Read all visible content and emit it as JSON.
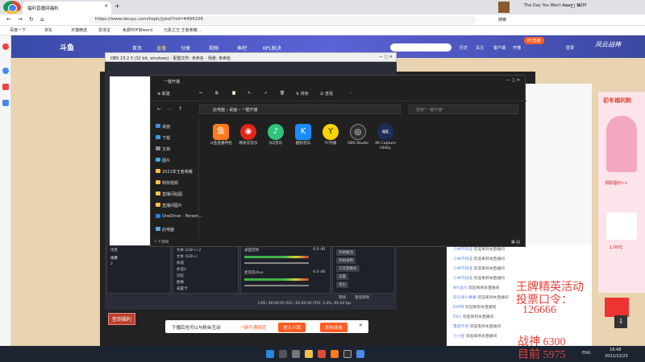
{
  "chrome": {
    "tab_title": "福利直播间福利",
    "url": "https://www.douyu.com/topic/jykzl?rid=4494106",
    "bookmarks": [
      "百度一下",
      "京东",
      "天猫精选",
      "爱淘宝",
      "免费PDF转word",
      "元素之王 王者荣耀..."
    ],
    "media_title": "The Day You Went Away - M2M",
    "search_hint": "搜索"
  },
  "douyu": {
    "logo": "斗鱼",
    "nav": [
      "首页",
      "直播",
      "分类",
      "视频",
      "鱼吧",
      "KPL秋决"
    ],
    "accent": "#ff5d23",
    "header_right": [
      "历史",
      "关注",
      "客户端",
      "开播",
      "PC直播",
      "登录"
    ],
    "sidebar_tag": "风云战神",
    "chat": [
      {
        "user": "小林不知道",
        "msg": "欢迎来到本直播间"
      },
      {
        "user": "小林不知道",
        "msg": "欢迎来到本直播间"
      },
      {
        "user": "小林不知道",
        "msg": "欢迎来到本直播间"
      },
      {
        "user": "小林不知道",
        "msg": "欢迎来到本直播间"
      },
      {
        "user": "Am温九",
        "msg": "欢迎来到本直播间"
      },
      {
        "user": "欢乐颂小果果",
        "msg": "欢迎来到本直播间"
      },
      {
        "user": "DrDM",
        "msg": "欢迎来到本直播间"
      },
      {
        "user": "Dicc",
        "msg": "欢迎来到本直播间"
      },
      {
        "user": "鲁班不哭",
        "msg": "欢迎来到本直播间"
      },
      {
        "user": "小小鱼",
        "msg": "欢迎来到本直播间"
      },
      {
        "user": "说吧",
        "msg": "欢迎来到本直播间"
      }
    ],
    "side_ad_title": "初冬福利购",
    "side_ad_sub": "领取福利>>",
    "badge": "1.00元",
    "overlay_lines": [
      "王牌精英活动",
      "投票口令：",
      "126666",
      "战神 6300",
      "目前 5975"
    ],
    "ad_bar": {
      "text": "下播后也可以与粉丝互动",
      "link": "一键开通频道",
      "btn1": "进入小窝",
      "btn2": "发布动态"
    }
  },
  "obs": {
    "title": "OBS 23.2.3 (32 bit, windows) - 配置文件: 未命名 - 场景: 未命名",
    "scene_header": "场景",
    "scenes": [
      "场景",
      "2"
    ],
    "sources": [
      "文本 (GDI+) 2",
      "文本 (GDI+)",
      "体道",
      "体道2",
      "浏览",
      "图像",
      "采置卡"
    ],
    "mixer": [
      "桌面音频",
      "麦克风/Aux"
    ],
    "db": [
      "-6.0 dB",
      "-6.0 dB"
    ],
    "controls": [
      "开始推流",
      "开始录制",
      "工作室模式",
      "设置",
      "退出"
    ],
    "transition_label": "转场",
    "transition_value": "渐变转场",
    "status": "LIVE: 00:00:00   REC: 00:00:00   CPU: 3.4%, 60.00 fps",
    "bottom_btn": "签到福利"
  },
  "explorer": {
    "title": "一键开播",
    "toolbar": [
      "新建",
      "排序",
      "查看"
    ],
    "path": [
      "此电脑",
      "桌面",
      "一键开播"
    ],
    "search_placeholder": "搜索\"一键开播\"",
    "nav": [
      "桌面",
      "下载",
      "文档",
      "图片",
      "2021年王者荣耀",
      "特效视频",
      "直播间贴图",
      "直播间图片",
      "OneDrive - Person...",
      "此电脑"
    ],
    "files": [
      {
        "name": "斗鱼直播伴侣",
        "color": "#ff7a1a",
        "glyph": "鱼"
      },
      {
        "name": "网易云音乐",
        "color": "#e1251b",
        "glyph": "◉"
      },
      {
        "name": "QQ音乐",
        "color": "#31c27c",
        "glyph": "♪"
      },
      {
        "name": "酷狗音乐",
        "color": "#1a8cff",
        "glyph": "K"
      },
      {
        "name": "YY开播",
        "color": "#f5d400",
        "glyph": "Y"
      },
      {
        "name": "OBS Studio",
        "color": "#302e31",
        "glyph": "◎"
      },
      {
        "name": "4K Capture Utility",
        "color": "#1d2d5a",
        "glyph": "4K"
      }
    ],
    "status": "7 个项目"
  },
  "taskbar": {
    "time": "18:48",
    "date": "2021/12/23",
    "tray": "ENG"
  }
}
